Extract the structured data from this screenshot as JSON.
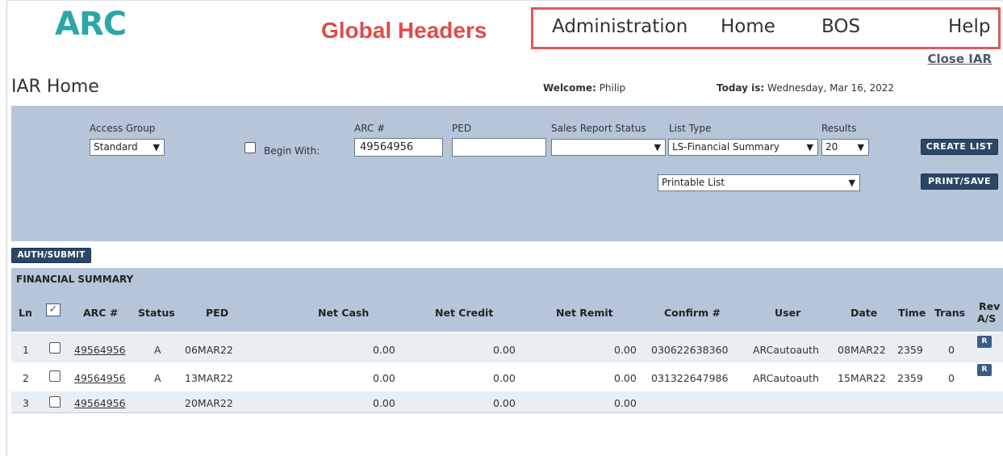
{
  "logo": "ARC",
  "annotation": "Global Headers",
  "global_nav": [
    "Administration",
    "Home",
    "BOS",
    "Help"
  ],
  "close_link": "Close IAR",
  "page_title": "IAR Home",
  "welcome": {
    "label": "Welcome:",
    "name": "Philip"
  },
  "today": {
    "label": "Today is:",
    "date": "Wednesday, Mar 16, 2022"
  },
  "filters": {
    "access_group": {
      "label": "Access Group",
      "value": "Standard"
    },
    "begin_with": {
      "label": "Begin With:",
      "checked": false
    },
    "arc_number": {
      "label": "ARC #",
      "value": "49564956"
    },
    "ped": {
      "label": "PED",
      "value": ""
    },
    "sales_report_status": {
      "label": "Sales Report Status",
      "value": ""
    },
    "list_type": {
      "label": "List Type",
      "value": "LS-Financial Summary"
    },
    "results": {
      "label": "Results",
      "value": "20"
    },
    "output": {
      "value": "Printable List"
    },
    "create_list": "CREATE LIST",
    "print_save": "PRINT/SAVE"
  },
  "auth_submit": "AUTH/SUBMIT",
  "table": {
    "title": "FINANCIAL SUMMARY",
    "headers": {
      "ln": "Ln",
      "arc": "ARC #",
      "status": "Status",
      "ped": "PED",
      "net_cash": "Net Cash",
      "net_credit": "Net Credit",
      "net_remit": "Net Remit",
      "confirm": "Confirm #",
      "user": "User",
      "date": "Date",
      "time": "Time",
      "trans": "Trans",
      "rev_line1": "Rev",
      "rev_line2": "A/S"
    },
    "rows": [
      {
        "ln": "1",
        "arc": "49564956",
        "status": "A",
        "ped": "06MAR22",
        "net_cash": "0.00",
        "net_credit": "0.00",
        "net_remit": "0.00",
        "confirm": "030622638360",
        "user": "ARCautoauth",
        "date": "08MAR22",
        "time": "2359",
        "trans": "0",
        "rev": "R"
      },
      {
        "ln": "2",
        "arc": "49564956",
        "status": "A",
        "ped": "13MAR22",
        "net_cash": "0.00",
        "net_credit": "0.00",
        "net_remit": "0.00",
        "confirm": "031322647986",
        "user": "ARCautoauth",
        "date": "15MAR22",
        "time": "2359",
        "trans": "0",
        "rev": "R"
      },
      {
        "ln": "3",
        "arc": "49564956",
        "status": "",
        "ped": "20MAR22",
        "net_cash": "0.00",
        "net_credit": "0.00",
        "net_remit": "0.00",
        "confirm": "",
        "user": "",
        "date": "",
        "time": "",
        "trans": "",
        "rev": ""
      }
    ]
  },
  "colors": {
    "brand": "#2aa6a9",
    "annotation": "#e04b4b",
    "panel": "#b6c6d8",
    "button": "#2c4766"
  }
}
